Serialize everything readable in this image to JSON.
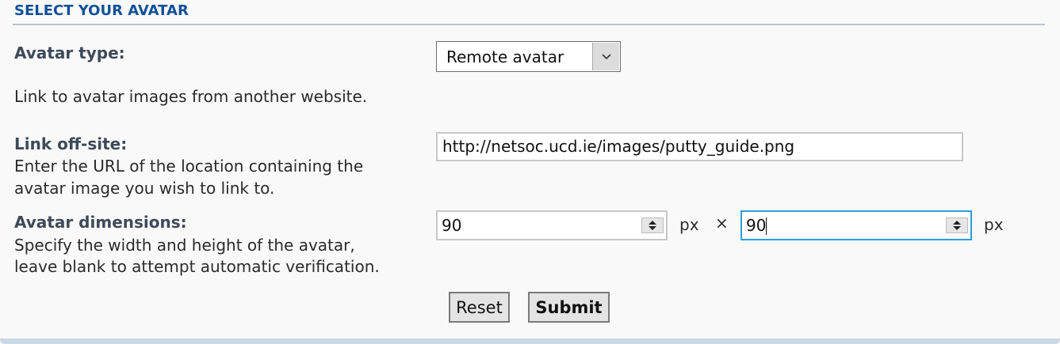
{
  "section": {
    "title": "SELECT YOUR AVATAR"
  },
  "avatar_type": {
    "label": "Avatar type:",
    "selected": "Remote avatar",
    "description": "Link to avatar images from another website."
  },
  "link_offsite": {
    "label": "Link off-site:",
    "desc_line1": "Enter the URL of the location containing the",
    "desc_line2": "avatar image you wish to link to.",
    "value": "http://netsoc.ucd.ie/images/putty_guide.png"
  },
  "dimensions": {
    "label": "Avatar dimensions:",
    "desc_line1": "Specify the width and height of the avatar,",
    "desc_line2": "leave blank to attempt automatic verification.",
    "width_value": "90",
    "height_value": "90",
    "unit": "px",
    "separator": "×"
  },
  "buttons": {
    "reset": "Reset",
    "submit": "Submit"
  },
  "colors": {
    "title": "#115098",
    "label": "#3e4a5a",
    "focus_border": "#2b9fd9"
  },
  "icons": {
    "select_arrow": "chevron-down-icon",
    "spinner": "spinner-arrows-icon"
  }
}
